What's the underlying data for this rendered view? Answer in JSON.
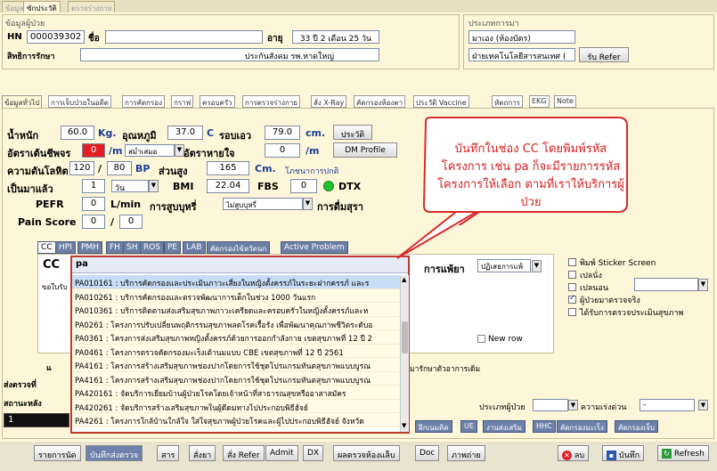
{
  "top_tabs": [
    "ข้อมูล",
    "ซักประวัติ",
    "ตรวจร่างกาย"
  ],
  "patient_panel": {
    "title": "ข้อมูลผู้ป่วย",
    "hn_label": "HN",
    "hn_value": "000039302",
    "name_label": "ชื่อ",
    "age_label": "อายุ",
    "age_value": "33 ปี 2 เดือน 25 วัน",
    "right_label": "สิทธิการรักษา",
    "right_value": "ประกันสังคม รพ.หาดใหญ่"
  },
  "service_panel": {
    "title": "ประเภทการมา",
    "visit_type": "มาเอง (ห้องบัตร)",
    "department": "ฝ่ายเทคโนโลยีสารสนเทศ (",
    "refer_button": "รับ Refer"
  },
  "main_tabs": [
    "ข้อมูลทั่วไป",
    "การเจ็บป่วยในอดีต",
    "การคัดกรอง",
    "กราฟ",
    "ครอบครัว",
    "การตรวจร่างกาย",
    "สั่ง X-Ray",
    "คัดกรองห้องตา",
    "ประวัติ Vaccine",
    "หัตถการ",
    "EKG",
    "Note"
  ],
  "vitals": {
    "weight_label": "น้ำหนัก",
    "weight": "60.0",
    "weight_unit": "Kg.",
    "temp_label": "อุณหภูมิ",
    "temp": "37.0",
    "temp_unit": "C",
    "waist_label": "รอบเอว",
    "waist": "79.0",
    "waist_unit": "cm.",
    "history_btn": "ประวัติ",
    "pulse_label": "อัตราเต้นชีพจร",
    "pulse": "0",
    "pulse_unit": "/m",
    "pulse_rhythm": "สม่ำเสมอ",
    "resp_label": "อัตราหายใจ",
    "resp": "0",
    "resp_unit": "/m",
    "dm_btn": "DM Profile",
    "bp_label": "ความดันโลหิต",
    "bp_sys": "120",
    "bp_dia": "80",
    "bp_unit": "BP",
    "height_label": "ส่วนสูง",
    "height": "165",
    "height_unit": "Cm.",
    "bmi_status": "โภชนาการปกติ",
    "onset_label": "เป็นมาแล้ว",
    "onset": "1",
    "onset_unit": "วัน",
    "bmi_label": "BMI",
    "bmi": "22.04",
    "fbs_label": "FBS",
    "fbs": "0",
    "dtx_label": "DTX",
    "pefr_label": "PEFR",
    "pefr": "0",
    "pefr_unit": "L/min",
    "smoke_label": "การสูบบุหรี่",
    "smoke": "ไม่สูบบุหรี่",
    "alcohol_label": "การดื่มสุรา",
    "pain_label": "Pain Score",
    "pain": "0",
    "pain_max": "0"
  },
  "sub_tabs": [
    "CC",
    "HPI",
    "PMH",
    "FH",
    "SH",
    "ROS",
    "PE",
    "LAB",
    "คัดกรองไข้หวัดนก",
    "Active Problem"
  ],
  "cc": {
    "label": "CC",
    "search_text": "pa",
    "reason_label": "ขอใบรับ",
    "allergy_label": "การแพ้ยา",
    "allergy_value": "ปฏิเสธการแพ้",
    "new_row": "New row"
  },
  "dropdown_items": [
    "PA010161 : บริการคัดกรองและประเมินภาวะเสี่ยงในหญิงตั้งครรภ์ในระยะฝากครรภ์ และร",
    "PA010261 : บริการคัดกรองและตรวจพัฒนาการเด็กในช่วง 1000 วันแรก",
    "PA010361 : บริการติดตามส่งเสริมสุขภาพภาวะเครียดและครอบครัวในหญิงตั้งครรภ์และห",
    "PA0261 : โครงการปรับเปลี่ยนพฤติกรรมสุขภาพลดโรคเรื้อรัง เพื่อพัฒนาคุณภาพชีวิตระดับอ",
    "PA0361 : โครงการส่งเสริมสุขภาพหญิงตั้งครรภ์ด้วยการออกกำลังกาย เขตสุขภาพที่ 12 ปี 2",
    "PA0461 : โครงการตรวจคัดกรองมะเร็งเต้านมแบบ CBE เขตสุขภาพที่ 12 ปี 2561",
    "PA4161 : โครงการสร้างเสริมสุขภาพช่องปากโดยการใช้ชุดโปรแกรมทันตสุขภาพแบบบูรณ",
    "PA4161 : โครงการสร้างเสริมสุขภาพช่องปากโดยการใช้ชุดโปรแกรมทันตสุขภาพแบบบูรณ",
    "PA420161 : จัดบริการเยี่ยมบ้านผู้ป่วยโรคโดยเจ้าหน้าที่สาธารณสุขหรืออาสาสมัคร",
    "PA420261 : จัดบริการสร้างเสริมสุขภาพในผู้ดีดมทางไปประกอบพิธีฮัจย์",
    "PA4261 : โครงการใกล้บ้านใกล้ใจ ใส่ใจสุขภาพผู้ป่วยโรคและผู้ไปประกอบพิธีฮัจย์ จังหวัด",
    "PA430161 : ประเมินคัดกรองและให้บริการสุขภาพที่เป็นมิตรสำหรับวัยรุ่นและเยาวชน และใ"
  ],
  "right_panel": {
    "sticker": "พิมพ์ Sticker Screen",
    "opt1": "เปลนั่ง",
    "opt2": "เปลนอน",
    "opt3": "ผู้ป่วยมาตรวจจริง",
    "opt4": "ได้รับการตรวจประเมินสุขภาพ"
  },
  "lower_form": {
    "referral_label": "ส่งตรวจที่",
    "status_label": "สถานะหลัง",
    "patient_type_label": "ประเภทผู้ป่วย",
    "urgency_label": "ความเร่งด่วน",
    "urgency_value": "-",
    "left_num": "1",
    "treatment_note": "มารักษาตัวอาการเดิม"
  },
  "action_buttons": [
    "ฝึกเนมคิด",
    "UE",
    "งานส่งเสริม",
    "HHC",
    "คัดกรองมะเร็ง",
    "คัดกรองเจ็บ"
  ],
  "bottom_buttons": [
    "รายการนัด",
    "บันทึกส่งตรวจ",
    "สาร",
    "สั่งยา",
    "สั่ง Refer",
    "Admit",
    "DX",
    "ผลตรวจห้องแล็บ",
    "Doc",
    "ภาพถ่าย"
  ],
  "bottom_right": {
    "delete": "ลบ",
    "save": "บันทึก",
    "refresh": "Refresh"
  },
  "callout_text": "บันทึกในช่อง CC โดยพิมพ์รหัสโครงการ เช่น pa ก็จะมีรายการรหัสโครงการให้เลือก ตามที่เราให้บริการผู้ป่วย",
  "colors": {
    "alert_red": "#e21e1e",
    "callout_border": "#d92b2b",
    "callout_text": "#d32020",
    "window_bg": "#fdf6d8",
    "tab_blue": "#6b7fa5"
  }
}
